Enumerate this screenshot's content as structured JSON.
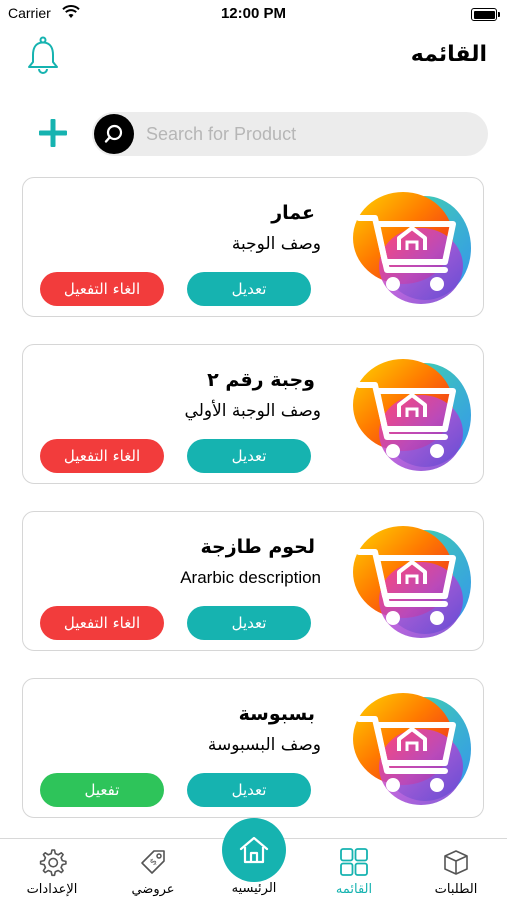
{
  "status": {
    "carrier": "Carrier",
    "time": "12:00 PM"
  },
  "header": {
    "title": "القائمه",
    "bell_icon": "bell-icon"
  },
  "search": {
    "placeholder": "Search for Product",
    "value": ""
  },
  "products": [
    {
      "title": "عمار",
      "description": "وصف الوجبة",
      "edit_label": "تعديل",
      "toggle_label": "الغاء التفعيل",
      "toggle_color": "#f23c3c"
    },
    {
      "title": "وجبة رقم ٢",
      "description": "وصف الوجبة الأولي",
      "edit_label": "تعديل",
      "toggle_label": "الغاء التفعيل",
      "toggle_color": "#f23c3c"
    },
    {
      "title": "لحوم طازجة",
      "description": "Ararbic description",
      "edit_label": "تعديل",
      "toggle_label": "الغاء التفعيل",
      "toggle_color": "#f23c3c"
    },
    {
      "title": "بسبوسة",
      "description": "وصف البسبوسة",
      "edit_label": "تعديل",
      "toggle_label": "تفعيل",
      "toggle_color": "#2ec45a"
    }
  ],
  "tabs": {
    "settings": "الإعدادات",
    "offers": "عروضي",
    "home": "الرئيسيه",
    "menu": "القائمه",
    "orders": "الطلبات"
  },
  "colors": {
    "accent": "#16b3b0",
    "danger": "#f23c3c",
    "success": "#2ec45a"
  }
}
